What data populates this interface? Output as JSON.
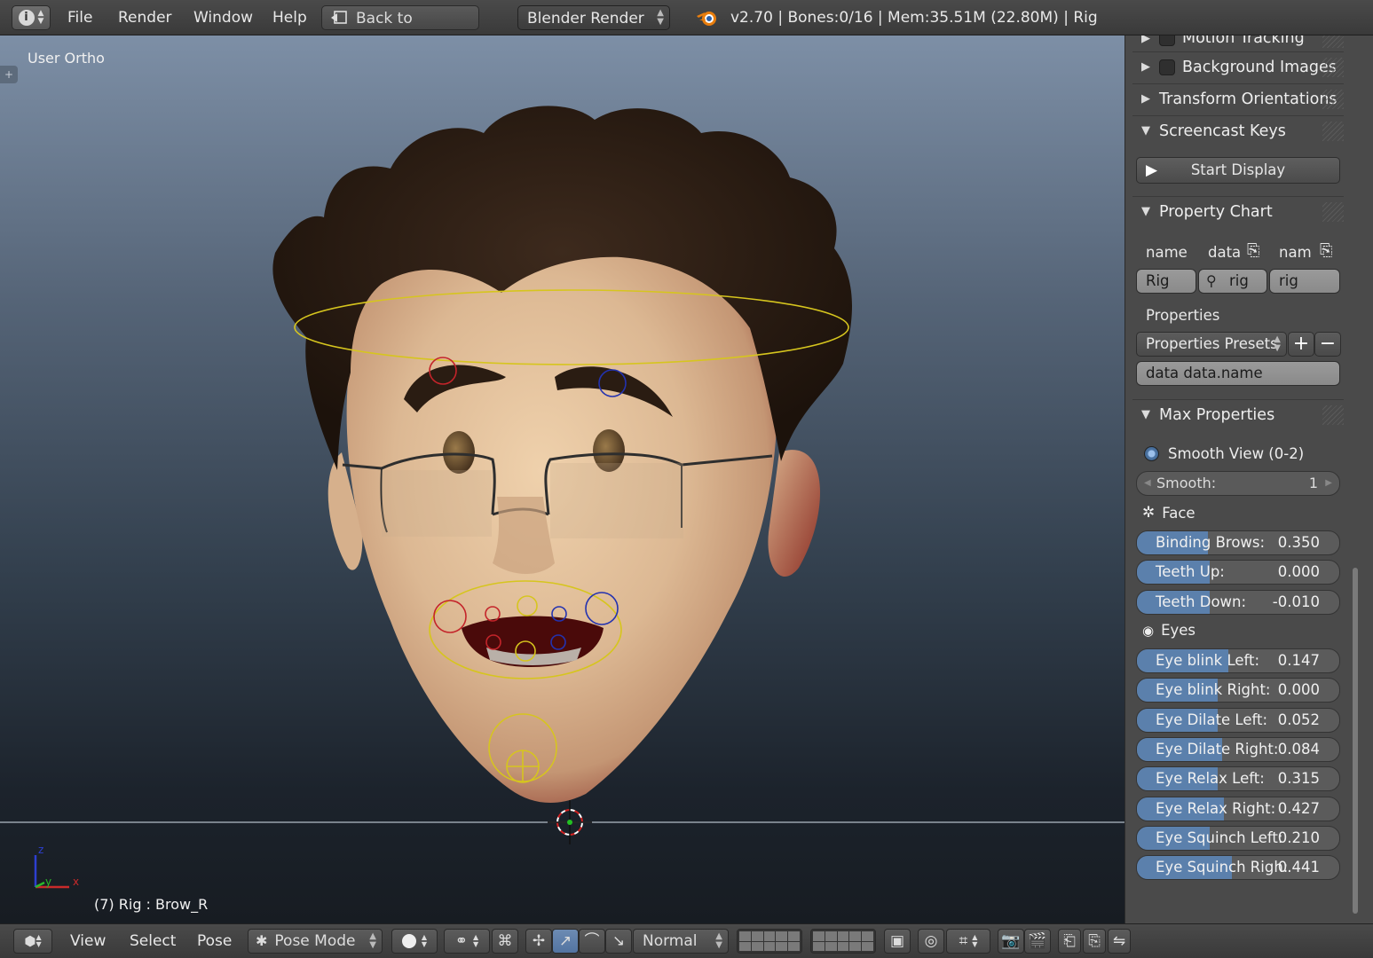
{
  "topbar": {
    "info_icon": "info-icon",
    "menus": [
      "File",
      "Render",
      "Window",
      "Help"
    ],
    "back_button": "Back to Previous",
    "render_engine": "Blender Render",
    "stats": "v2.70 | Bones:0/16  | Mem:35.51M (22.80M) | Rig"
  },
  "viewport": {
    "view_name": "User Ortho",
    "status": "(7) Rig : Brow_R",
    "axis_labels": [
      "z",
      "y",
      "x"
    ]
  },
  "panel": {
    "motion_tracking": "Motion Tracking",
    "background_images": "Background Images",
    "transform_orientations": "Transform Orientations",
    "screencast_keys": "Screencast Keys",
    "start_display": "Start Display",
    "property_chart": "Property Chart",
    "chart_cols": [
      "name",
      "data",
      "nam"
    ],
    "chart_fields": [
      "Rig",
      "rig",
      "rig"
    ],
    "properties_label": "Properties",
    "properties_presets": "Properties Presets",
    "data_path": "data data.name",
    "max_properties": "Max Properties",
    "smooth_view": "Smooth View (0-2)",
    "smooth_label": "Smooth:",
    "smooth_value": "1",
    "face_label": "Face",
    "face_sliders": [
      {
        "label": "Binding Brows:",
        "value": "0.350",
        "fill": 0.35
      },
      {
        "label": "Teeth Up:",
        "value": "0.000",
        "fill": 0.36
      },
      {
        "label": "Teeth Down:",
        "value": "-0.010",
        "fill": 0.36
      }
    ],
    "eyes_label": "Eyes",
    "eye_sliders": [
      {
        "label": "Eye blink Left:",
        "value": "0.147",
        "fill": 0.45
      },
      {
        "label": "Eye blink Right:",
        "value": "0.000",
        "fill": 0.4
      },
      {
        "label": "Eye Dilate Left:",
        "value": "0.052",
        "fill": 0.4
      },
      {
        "label": "Eye Dilate Right:",
        "value": "0.084",
        "fill": 0.42
      },
      {
        "label": "Eye Relax Left:",
        "value": "0.315",
        "fill": 0.4
      },
      {
        "label": "Eye Relax Right:",
        "value": "0.427",
        "fill": 0.43
      },
      {
        "label": "Eye Squinch Left:",
        "value": "0.210",
        "fill": 0.36
      },
      {
        "label": "Eye Squinch Righ:",
        "value": "0.441",
        "fill": 0.47
      }
    ]
  },
  "bottombar": {
    "menus": [
      "View",
      "Select",
      "Pose"
    ],
    "mode": "Pose Mode",
    "pivot": "Normal"
  },
  "colors": {
    "slider_fill": "#5b80ac",
    "ring_yellow": "#d6c51e",
    "ring_red": "#c4242a",
    "ring_blue": "#2332b0"
  }
}
